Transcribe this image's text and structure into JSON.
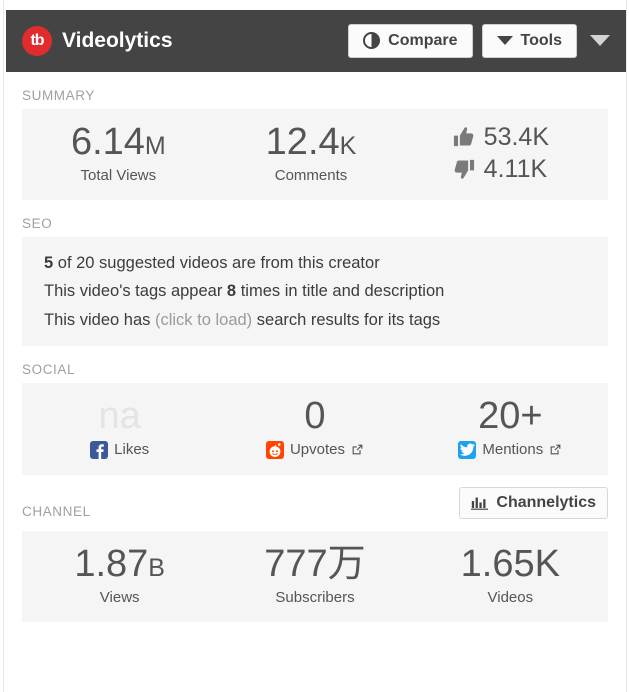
{
  "header": {
    "logo_text": "tb",
    "brand_name": "Videolytics",
    "compare_label": "Compare",
    "tools_label": "Tools",
    "brand_color": "#e02c2c",
    "bar_color": "#444444"
  },
  "summary": {
    "label": "SUMMARY",
    "stats": [
      {
        "value": "6.14",
        "suffix": "M",
        "label": "Total Views"
      },
      {
        "value": "12.4",
        "suffix": "K",
        "label": "Comments"
      }
    ],
    "ratings": {
      "likes": "53.4K",
      "dislikes": "4.11K"
    }
  },
  "seo": {
    "label": "SEO",
    "lines": [
      {
        "strong1": "5",
        "mid": " of 20 suggested videos are from this creator"
      },
      {
        "pre": "This video's tags appear ",
        "strong1": "8",
        "mid": " times in title and description"
      },
      {
        "pre": "This video has ",
        "dim": "(click to load)",
        "mid": " search results for its tags"
      }
    ]
  },
  "social": {
    "label": "SOCIAL",
    "items": [
      {
        "value": "na",
        "muted": true,
        "label": "Likes",
        "icon": "facebook-icon",
        "external": false
      },
      {
        "value": "0",
        "muted": false,
        "label": "Upvotes",
        "icon": "reddit-icon",
        "external": true
      },
      {
        "value": "20+",
        "muted": false,
        "label": "Mentions",
        "icon": "twitter-icon",
        "external": true
      }
    ]
  },
  "channel": {
    "label": "CHANNEL",
    "channelytics_label": "Channelytics",
    "stats": [
      {
        "value": "1.87",
        "suffix": "B",
        "label": "Views"
      },
      {
        "value": "777万",
        "suffix": "",
        "label": "Subscribers"
      },
      {
        "value": "1.65K",
        "suffix": "",
        "label": "Videos"
      }
    ]
  }
}
